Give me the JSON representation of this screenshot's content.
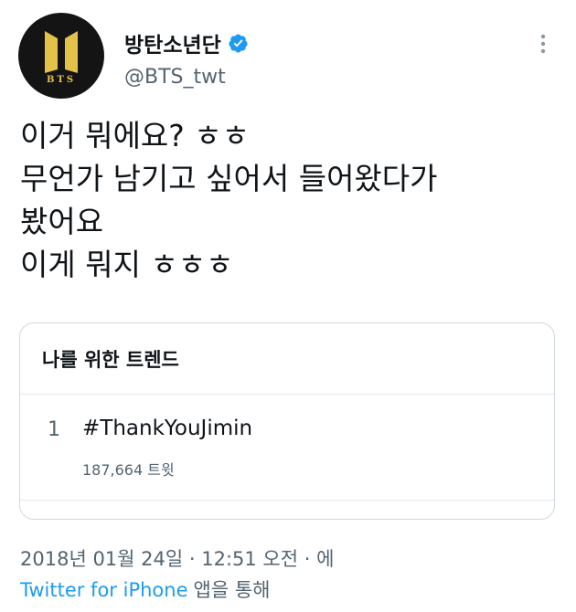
{
  "account": {
    "display_name": "방탄소년단",
    "handle": "@BTS_twt",
    "avatar_text": "BTS",
    "verified_icon": "verified-badge-icon",
    "more_icon": "more-options-icon"
  },
  "tweet": {
    "lines": [
      "이거 뭐에요? ㅎㅎ",
      "무언가 남기고 싶어서 들어왔다가",
      "봤어요",
      "이게 뭐지 ㅎㅎㅎ"
    ]
  },
  "trends_card": {
    "title": "나를 위한 트렌드",
    "items": [
      {
        "rank": "1",
        "tag": "#ThankYouJimin",
        "count": "187,664 트윗"
      }
    ]
  },
  "meta": {
    "timestamp": "2018년 01월 24일 · 12:51 오전 · 에",
    "source_link": "Twitter for iPhone",
    "source_suffix": "앱을 통해"
  },
  "colors": {
    "text": "#0f1419",
    "secondary": "#536471",
    "link": "#1d9bf0",
    "verified": "#1d9bf0",
    "avatar_bg": "#141414",
    "avatar_logo": "#e4c24a"
  }
}
